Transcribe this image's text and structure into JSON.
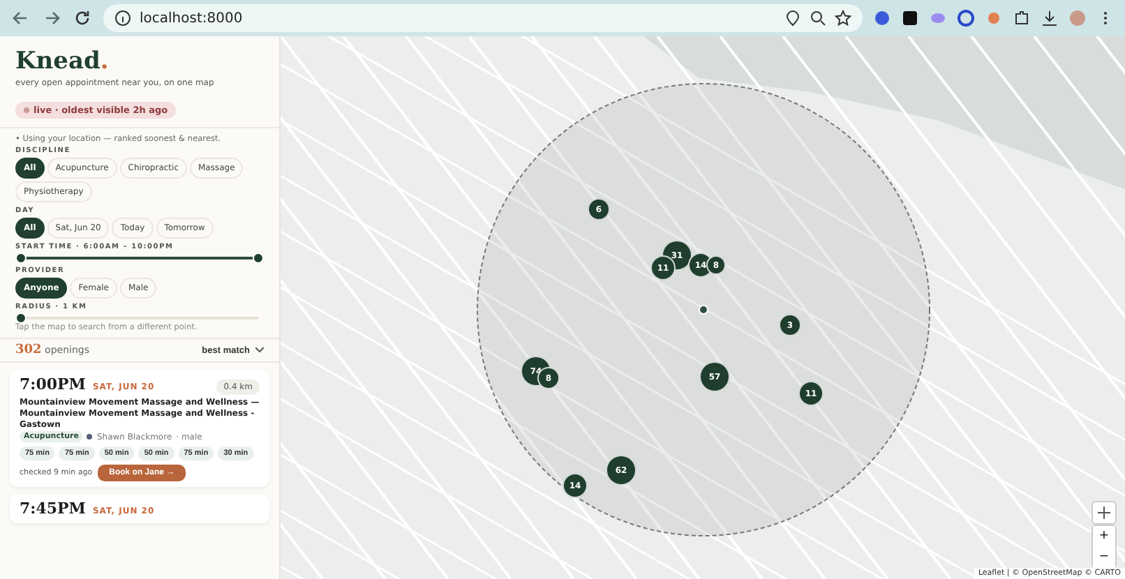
{
  "browser": {
    "url": "localhost:8000"
  },
  "brand": {
    "name": "Knead",
    "dot": ".",
    "tagline": "every open appointment near you, on one map",
    "live_badge": "live · oldest visible 2h ago"
  },
  "location_note": "• Using your location — ranked soonest & nearest.",
  "filters": [
    {
      "label": "DISCIPLINE",
      "kind": "chips",
      "options": [
        {
          "label": "All",
          "selected": true
        },
        {
          "label": "Acupuncture",
          "selected": false
        },
        {
          "label": "Chiropractic",
          "selected": false
        },
        {
          "label": "Massage",
          "selected": false
        },
        {
          "label": "Physiotherapy",
          "selected": false
        }
      ]
    },
    {
      "label": "DAY",
      "kind": "chips",
      "options": [
        {
          "label": "All",
          "selected": true
        },
        {
          "label": "Sat, Jun 20",
          "selected": false
        },
        {
          "label": "Today",
          "selected": false
        },
        {
          "label": "Tomorrow",
          "selected": false
        }
      ]
    },
    {
      "label": "START TIME · 6:00AM – 10:00PM",
      "kind": "range",
      "level": 1
    },
    {
      "label": "PROVIDER",
      "kind": "chips",
      "options": [
        {
          "label": "Anyone",
          "selected": true
        },
        {
          "label": "Female",
          "selected": false
        },
        {
          "label": "Male",
          "selected": false
        }
      ]
    },
    {
      "label": "RADIUS · 1 KM",
      "kind": "slider",
      "level": 0
    }
  ],
  "map_hint": "Tap the map to search from a different point.",
  "results": {
    "count": "302",
    "count_label": "openings",
    "sort": "best match"
  },
  "cards": [
    {
      "time": "7:00PM",
      "day": "SAT, JUN 20",
      "distance": "0.4 km",
      "title": "Mountainview Movement Massage and Wellness — Mountainview Movement Massage and Wellness - Gastown",
      "tag": "Acupuncture",
      "provider": "Shawn Blackmore",
      "gender": "· male",
      "durations": [
        "75 min",
        "75 min",
        "50 min",
        "50 min",
        "75 min",
        "30 min"
      ],
      "checked": "checked 9 min ago",
      "book": "Book on Jane →"
    },
    {
      "time": "7:45PM",
      "day": "SAT, JUN 20"
    }
  ],
  "clusters": [
    "6",
    "31",
    "11",
    "14",
    "8",
    "3",
    "74",
    "8",
    "57",
    "11",
    "62",
    "14"
  ],
  "map_controls": {
    "zoom_in": "+",
    "zoom_out": "−"
  },
  "attribution": "Leaflet | © OpenStreetMap © CARTO"
}
